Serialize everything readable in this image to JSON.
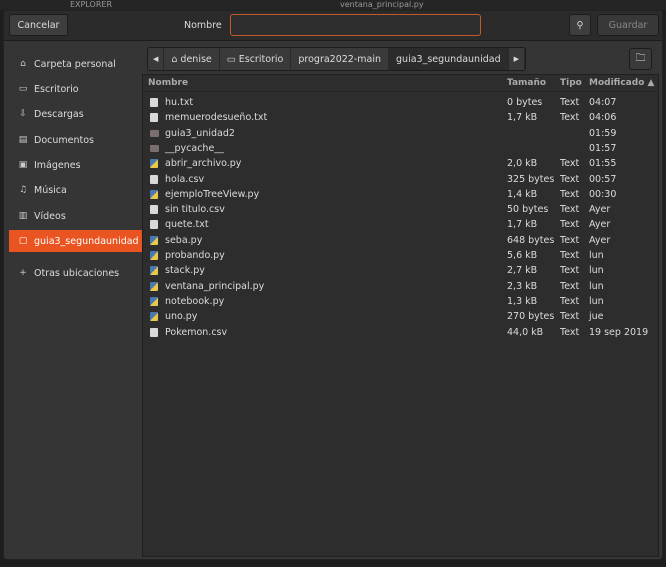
{
  "background": {
    "explorer_label": "EXPLORER",
    "editor_tab": "ventana_principal.py"
  },
  "header": {
    "cancel_label": "Cancelar",
    "name_label": "Nombre",
    "name_value": "",
    "save_label": "Guardar",
    "accent": "#e95420"
  },
  "sidebar": {
    "items": [
      {
        "label": "Carpeta personal",
        "icon": "home-icon"
      },
      {
        "label": "Escritorio",
        "icon": "desktop-icon"
      },
      {
        "label": "Descargas",
        "icon": "download-icon"
      },
      {
        "label": "Documentos",
        "icon": "document-icon"
      },
      {
        "label": "Imágenes",
        "icon": "image-icon"
      },
      {
        "label": "Música",
        "icon": "music-icon"
      },
      {
        "label": "Vídeos",
        "icon": "video-icon"
      },
      {
        "label": "guia3_segundaunidad",
        "icon": "folder-icon",
        "active": true
      },
      {
        "label": "Otras ubicaciones",
        "icon": "plus-icon"
      }
    ]
  },
  "path": [
    "denise",
    "Escritorio",
    "progra2022-main",
    "guia3_segundaunidad"
  ],
  "columns": {
    "name": "Nombre",
    "size": "Tamaño",
    "type": "Tipo",
    "modified": "Modificado"
  },
  "files": [
    {
      "name": "hu.txt",
      "size": "0 bytes",
      "type": "Text",
      "modified": "04:07",
      "kind": "txt"
    },
    {
      "name": "memuerodesueño.txt",
      "size": "1,7 kB",
      "type": "Text",
      "modified": "04:06",
      "kind": "txt"
    },
    {
      "name": "guia3_unidad2",
      "size": "",
      "type": "",
      "modified": "01:59",
      "kind": "dir"
    },
    {
      "name": "__pycache__",
      "size": "",
      "type": "",
      "modified": "01:57",
      "kind": "dir"
    },
    {
      "name": "abrir_archivo.py",
      "size": "2,0 kB",
      "type": "Text",
      "modified": "01:55",
      "kind": "py"
    },
    {
      "name": "hola.csv",
      "size": "325 bytes",
      "type": "Text",
      "modified": "00:57",
      "kind": "txt"
    },
    {
      "name": "ejemploTreeView.py",
      "size": "1,4 kB",
      "type": "Text",
      "modified": "00:30",
      "kind": "py"
    },
    {
      "name": "sin titulo.csv",
      "size": "50 bytes",
      "type": "Text",
      "modified": "Ayer",
      "kind": "txt"
    },
    {
      "name": "quete.txt",
      "size": "1,7 kB",
      "type": "Text",
      "modified": "Ayer",
      "kind": "txt"
    },
    {
      "name": "seba.py",
      "size": "648 bytes",
      "type": "Text",
      "modified": "Ayer",
      "kind": "py"
    },
    {
      "name": "probando.py",
      "size": "5,6 kB",
      "type": "Text",
      "modified": "lun",
      "kind": "py"
    },
    {
      "name": "stack.py",
      "size": "2,7 kB",
      "type": "Text",
      "modified": "lun",
      "kind": "py"
    },
    {
      "name": "ventana_principal.py",
      "size": "2,3 kB",
      "type": "Text",
      "modified": "lun",
      "kind": "py"
    },
    {
      "name": "notebook.py",
      "size": "1,3 kB",
      "type": "Text",
      "modified": "lun",
      "kind": "py"
    },
    {
      "name": "uno.py",
      "size": "270 bytes",
      "type": "Text",
      "modified": "jue",
      "kind": "py"
    },
    {
      "name": "Pokemon.csv",
      "size": "44,0 kB",
      "type": "Text",
      "modified": "19 sep 2019",
      "kind": "txt"
    }
  ]
}
